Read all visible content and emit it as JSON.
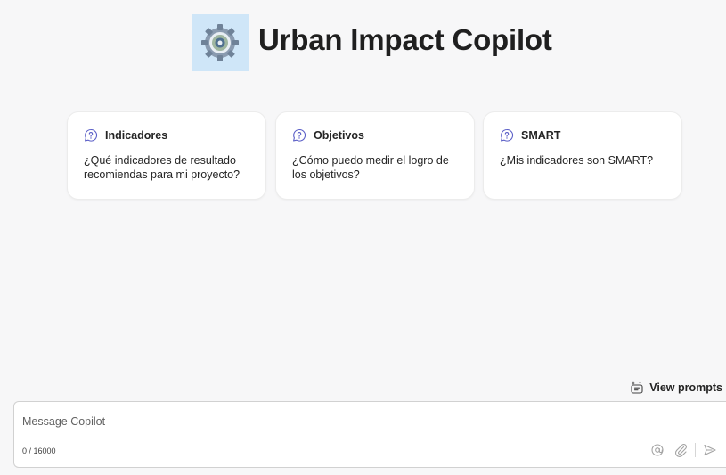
{
  "app": {
    "title": "Urban Impact Copilot"
  },
  "prompt_cards": [
    {
      "title": "Indicadores",
      "body": "¿Qué indicadores de resultado recomiendas para mi proyecto?",
      "icon": "chat-bubble-help-icon"
    },
    {
      "title": "Objetivos",
      "body": "¿Cómo puedo medir el logro de los objetivos?",
      "icon": "chat-bubble-help-icon"
    },
    {
      "title": "SMART",
      "body": "¿Mis indicadores son SMART?",
      "icon": "chat-bubble-help-icon"
    }
  ],
  "view_prompts": {
    "label": "View prompts",
    "icon": "prompt-sparkle-icon"
  },
  "composer": {
    "placeholder": "Message Copilot",
    "char_count": "0 / 16000",
    "icons": [
      "mention-icon",
      "attach-icon",
      "send-icon"
    ]
  },
  "colors": {
    "background": "#f7f7f8",
    "card_icon": "#5b5fc7",
    "logo_bg": "#cfe6f8"
  }
}
